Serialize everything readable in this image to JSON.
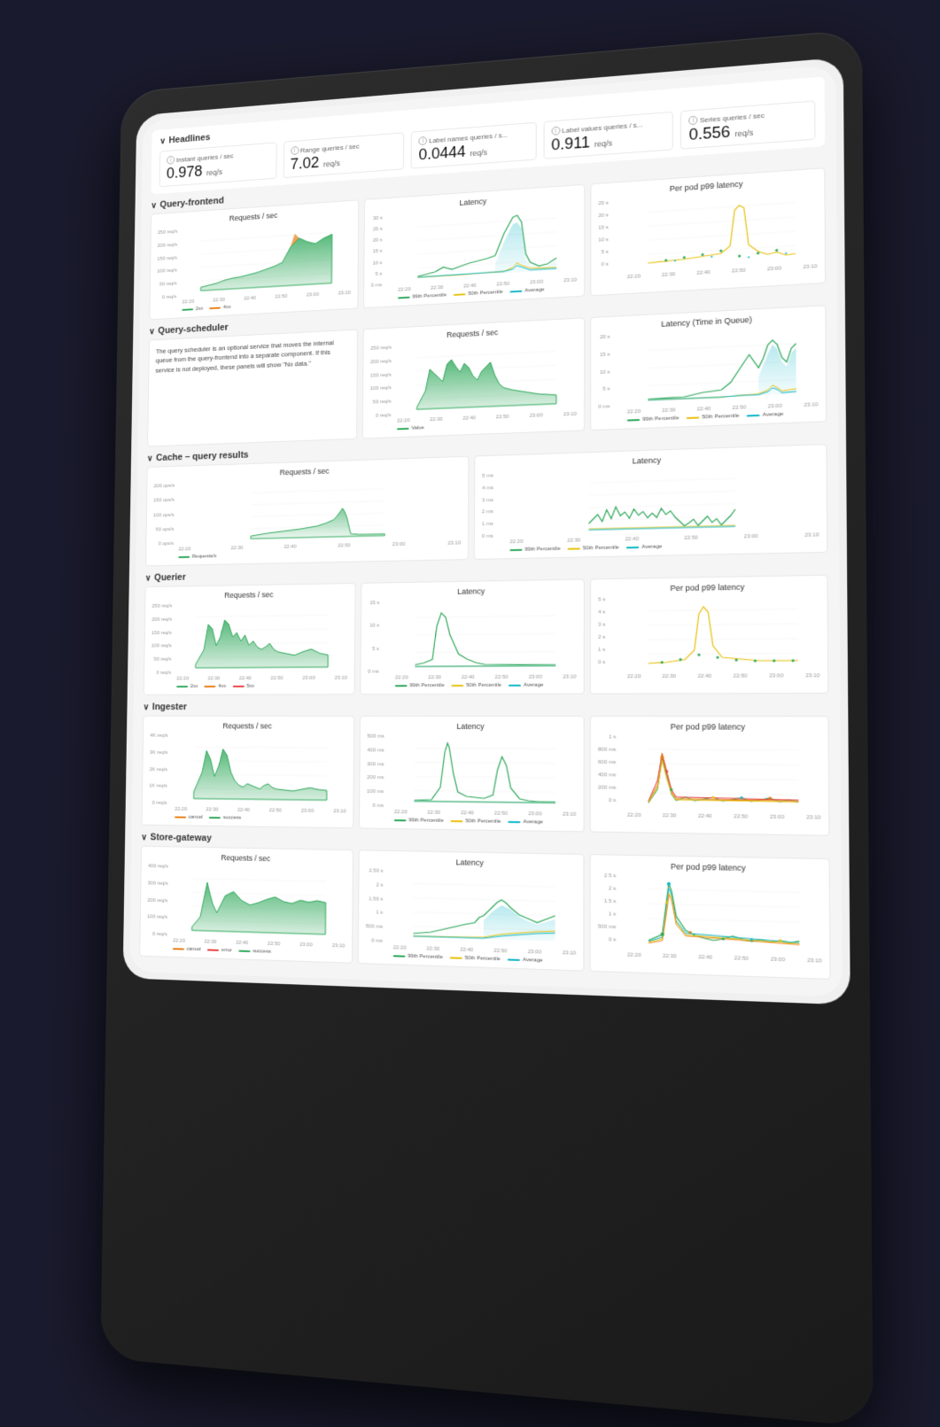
{
  "tablet": {
    "headlines": {
      "label": "Headlines",
      "metrics": [
        {
          "label": "Instant queries / sec",
          "value": "0.978",
          "unit": "req/s"
        },
        {
          "label": "Range queries / sec",
          "value": "7.02",
          "unit": "req/s"
        },
        {
          "label": "Label names queries / s...",
          "value": "0.0444",
          "unit": "req/s"
        },
        {
          "label": "Label values queries / s...",
          "value": "0.911",
          "unit": "req/s"
        },
        {
          "label": "Series queries / sec",
          "value": "0.556",
          "unit": "req/s"
        }
      ]
    },
    "sections": [
      {
        "name": "Query-frontend",
        "charts": [
          {
            "title": "Requests / sec",
            "type": "area-multi"
          },
          {
            "title": "Latency",
            "type": "area-multi"
          },
          {
            "title": "Per pod p99 latency",
            "type": "scatter"
          }
        ]
      },
      {
        "name": "Query-scheduler",
        "description": "The query scheduler is an optional service that moves the internal queue from the query-frontend into a separate component. If this service is not deployed, these panels will show \"No data.\"",
        "charts": [
          {
            "title": "Requests / sec",
            "type": "area"
          },
          {
            "title": "Latency (Time in Queue)",
            "type": "area-multi"
          }
        ]
      },
      {
        "name": "Cache – query results",
        "charts": [
          {
            "title": "Requests / sec",
            "type": "area"
          },
          {
            "title": "Latency",
            "type": "line-multi"
          }
        ]
      },
      {
        "name": "Querier",
        "charts": [
          {
            "title": "Requests / sec",
            "type": "area-multi"
          },
          {
            "title": "Latency",
            "type": "area-multi"
          },
          {
            "title": "Per pod p99 latency",
            "type": "scatter"
          }
        ]
      },
      {
        "name": "Ingester",
        "charts": [
          {
            "title": "Requests / sec",
            "type": "area-multi"
          },
          {
            "title": "Latency",
            "type": "area-multi"
          },
          {
            "title": "Per pod p99 latency",
            "type": "scatter-multi"
          }
        ]
      },
      {
        "name": "Store-gateway",
        "charts": [
          {
            "title": "Requests / sec",
            "type": "area-multi"
          },
          {
            "title": "Latency",
            "type": "area-shaded"
          },
          {
            "title": "Per pod p99 latency",
            "type": "scatter-colorful"
          }
        ]
      }
    ],
    "xLabels": [
      "22:20",
      "22:30",
      "22:40",
      "22:50",
      "23:00",
      "23:10"
    ],
    "colors": {
      "green": "#2ea85a",
      "orange": "#e87d12",
      "yellow": "#e8c212",
      "teal": "#12b8c8",
      "red": "#e84040",
      "lightGreen": "#7bc67e",
      "pink": "#e87db8"
    }
  }
}
